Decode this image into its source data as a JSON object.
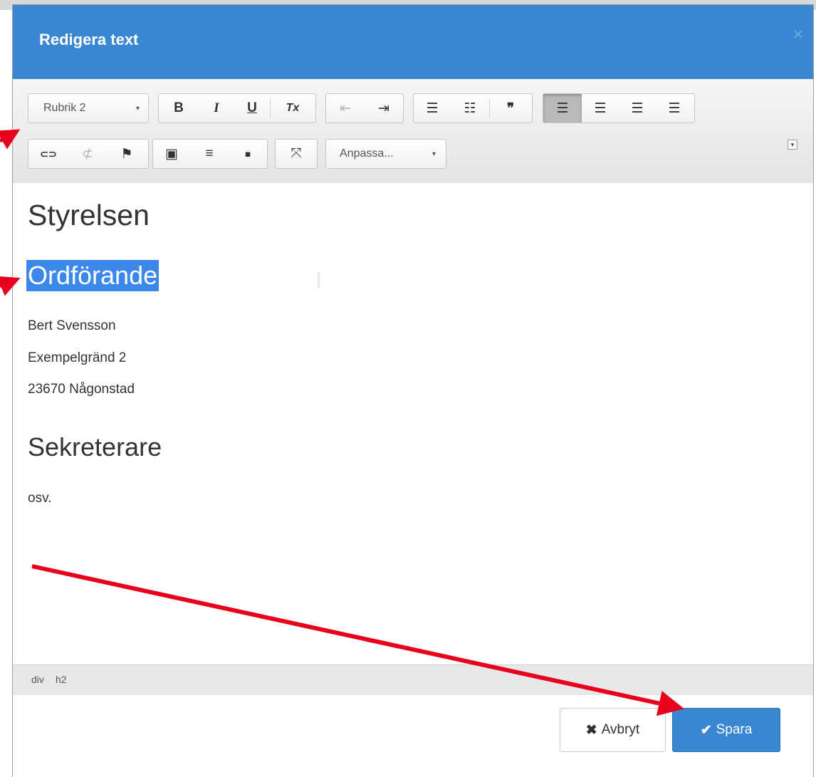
{
  "dialog": {
    "title": "Redigera text",
    "close_icon": "×"
  },
  "toolbar": {
    "format_value": "Rubrik 2",
    "style_value": "Anpassa...",
    "caret": "▾",
    "icons": {
      "bold": "B",
      "italic": "I",
      "underline": "U",
      "remove_format": "Tx",
      "outdent": "⇤",
      "indent": "⇥",
      "numbered_list": "☰",
      "bulleted_list": "☷",
      "blockquote": "❞",
      "align_left": "☰",
      "align_center": "☰",
      "align_right": "☰",
      "justify": "☰",
      "link": "⊂⊃",
      "unlink": "⊄",
      "anchor": "⚑",
      "image": "▣",
      "horizontal_rule": "≡",
      "iframe": "▪",
      "maximize": "⤧"
    },
    "expand_icon": "▾"
  },
  "content": {
    "heading_main": "Styrelsen",
    "heading_selected": "Ordförande",
    "address_lines": [
      "Bert Svensson",
      "Exempelgränd 2",
      "23670 Någonstad"
    ],
    "heading_second": "Sekreterare",
    "trailing_text": "osv."
  },
  "statusbar": {
    "path": [
      "div",
      "h2"
    ]
  },
  "footer": {
    "cancel_label": "Avbryt",
    "cancel_icon": "✖",
    "save_label": "Spara",
    "save_icon": "✔"
  },
  "colors": {
    "header": "#3a87d1",
    "selection": "#3b88ea",
    "annotation_arrow": "#e8001c",
    "save_button": "#3a87d1"
  }
}
